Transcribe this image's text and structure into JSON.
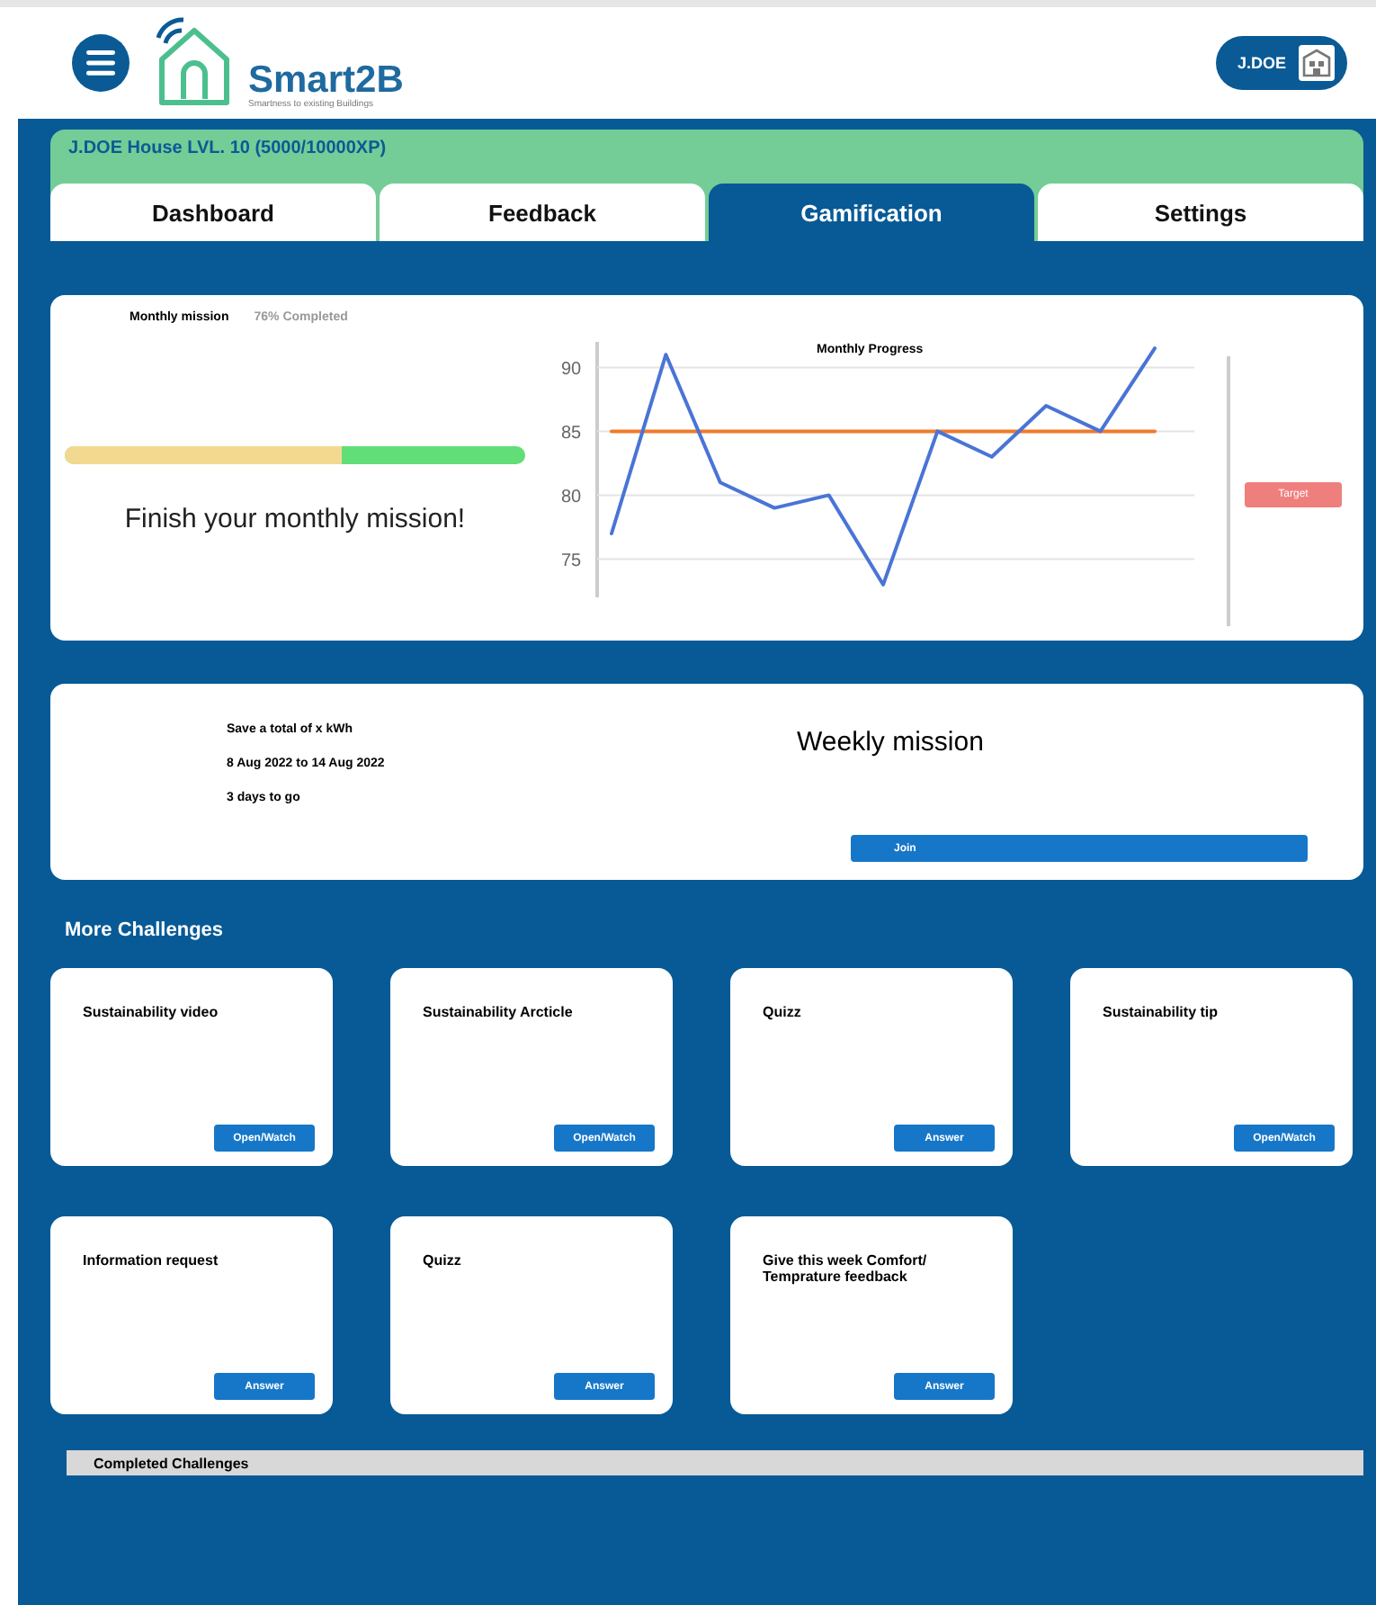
{
  "header": {
    "brand": "Smart2B",
    "tagline": "Smartness to existing Buildings",
    "user": "J.DOE"
  },
  "banner": {
    "title": "J.DOE House LVL. 10 (5000/10000XP)"
  },
  "tabs": [
    {
      "label": "Dashboard",
      "selected": false
    },
    {
      "label": "Feedback",
      "selected": false
    },
    {
      "label": "Gamification",
      "selected": true
    },
    {
      "label": "Settings",
      "selected": false
    }
  ],
  "monthly": {
    "title": "Monthly mission",
    "status": "76% Completed",
    "level": 0.6,
    "message": "Finish your monthly mission!",
    "chart_data": {
      "type": "line",
      "title": "Monthly Progress",
      "grid": true,
      "ylim": [
        72,
        92
      ],
      "yticks": [
        75,
        80,
        85,
        90
      ],
      "series": [
        {
          "color": "#4a74d6",
          "values": [
            77,
            91,
            81,
            79,
            80,
            73,
            85,
            83,
            87,
            85,
            91.5
          ]
        },
        {
          "name": "Target",
          "color": "#f07a2a",
          "values": [
            85,
            85,
            85,
            85,
            85,
            85,
            85,
            85,
            85,
            85,
            85
          ]
        }
      ]
    }
  },
  "weekly": {
    "lines": [
      "Save a total of x kWh",
      "8 Aug 2022 to 14 Aug 2022",
      "3 days to go"
    ],
    "title": "Weekly mission",
    "button": "Join"
  },
  "challenges_title": "More Challenges",
  "challenges": [
    {
      "title": "Sustainability video",
      "button": "Open/Watch"
    },
    {
      "title": "Sustainability Arcticle",
      "button": "Open/Watch"
    },
    {
      "title": "Quizz",
      "button": "Answer"
    },
    {
      "title": "Sustainability tip",
      "button": "Open/Watch"
    },
    {
      "title": "Information request",
      "button": "Answer"
    },
    {
      "title": "Quizz",
      "button": "Answer"
    },
    {
      "title": "Give this week Comfort/ Temprature feedback",
      "button": "Answer"
    }
  ],
  "completed": {
    "title": "Completed Challenges"
  }
}
